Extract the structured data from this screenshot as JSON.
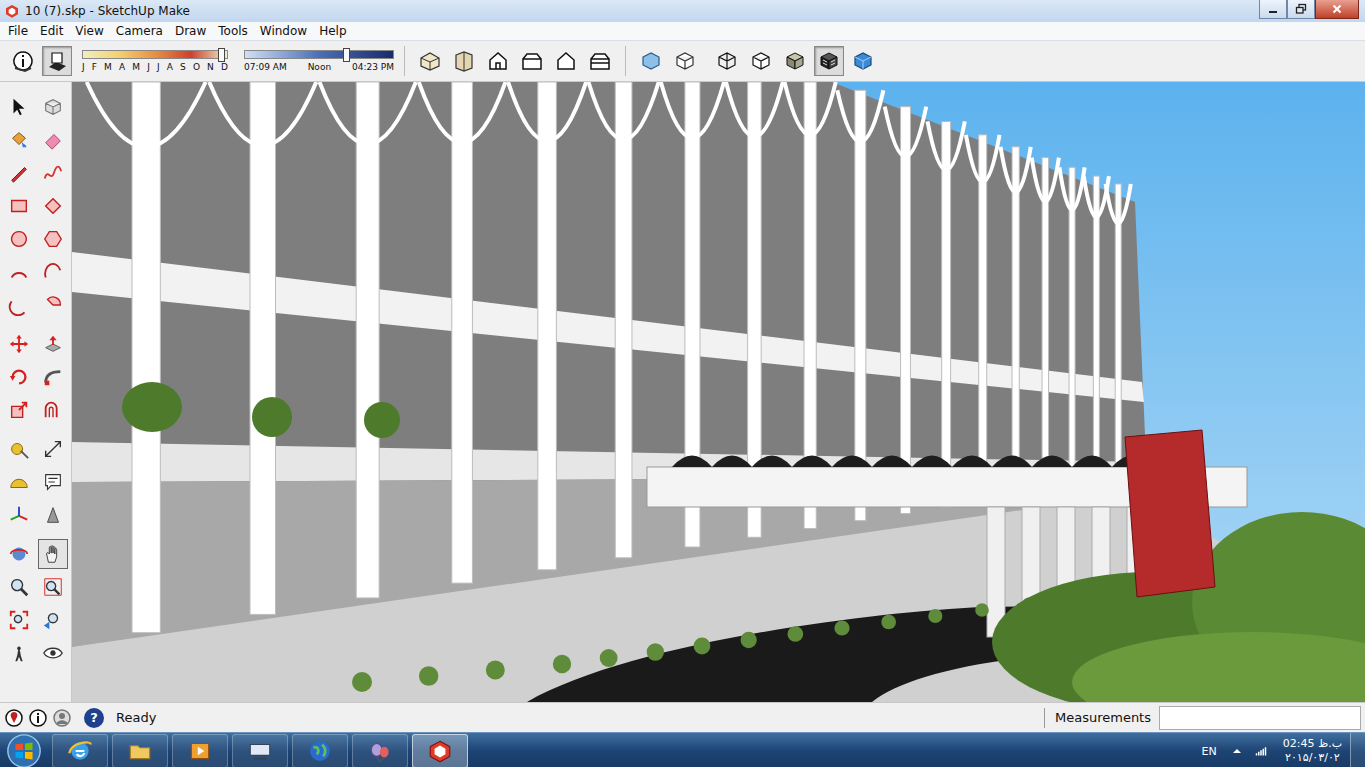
{
  "window": {
    "title": "10 (7).skp - SketchUp Make"
  },
  "menu": [
    "File",
    "Edit",
    "View",
    "Camera",
    "Draw",
    "Tools",
    "Window",
    "Help"
  ],
  "toolbar": {
    "shadow_buttons": [
      {
        "selected": false
      },
      {
        "selected": true
      }
    ],
    "shadow": {
      "months": [
        "J",
        "F",
        "M",
        "A",
        "M",
        "J",
        "J",
        "A",
        "S",
        "O",
        "N",
        "D"
      ],
      "month_level": 0.96,
      "times": [
        "07:09 AM",
        "Noon",
        "04:23 PM"
      ],
      "time_level": 0.68
    },
    "views": [
      {
        "selected": false
      },
      {
        "selected": false
      },
      {
        "selected": false
      },
      {
        "selected": false
      },
      {
        "selected": false
      },
      {
        "selected": false
      }
    ],
    "styles": [
      {
        "selected": false
      },
      {
        "selected": false
      },
      {
        "selected": false
      },
      {
        "selected": false
      },
      {
        "selected": false
      },
      {
        "selected": true
      },
      {
        "selected": false
      }
    ]
  },
  "tools": [
    {
      "selected": false
    },
    {
      "selected": false
    },
    {
      "selected": false
    },
    {
      "selected": false
    },
    {
      "selected": false
    },
    {
      "selected": false
    },
    {
      "selected": false
    },
    {
      "selected": false
    },
    {
      "selected": false
    },
    {
      "selected": false
    },
    {
      "selected": false
    },
    {
      "selected": false
    },
    {
      "selected": false
    },
    {
      "selected": false
    },
    {
      "selected": false
    },
    {
      "selected": false
    },
    {
      "selected": false
    },
    {
      "selected": false
    },
    {
      "selected": false
    },
    {
      "selected": false
    },
    {
      "selected": false
    },
    {
      "selected": false
    },
    {
      "selected": false
    },
    {
      "selected": false
    },
    {
      "selected": false
    },
    {
      "selected": false
    },
    {
      "selected": false
    },
    {
      "selected": true
    },
    {
      "selected": false
    },
    {
      "selected": false
    },
    {
      "selected": false
    },
    {
      "selected": false
    },
    {
      "selected": false
    },
    {
      "selected": false
    }
  ],
  "status_bar": {
    "help": "?",
    "text": "Ready",
    "measurements_label": "Measurements"
  },
  "taskbar": {
    "apps": [
      {
        "selected": false
      },
      {
        "selected": false
      },
      {
        "selected": false
      },
      {
        "selected": false
      },
      {
        "selected": false
      },
      {
        "selected": false
      },
      {
        "selected": true
      }
    ],
    "language": "EN",
    "time": "ب.ظ 02:45",
    "date": "۲۰۱۵/۰۳/۰۲"
  }
}
